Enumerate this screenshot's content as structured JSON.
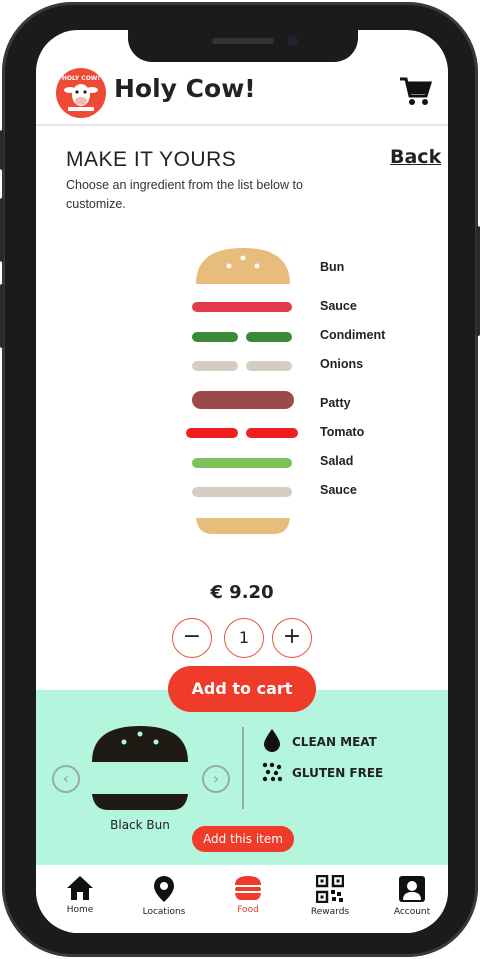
{
  "header": {
    "title": "Holy Cow!",
    "logo_text": "HOLY COW!"
  },
  "customize": {
    "title": "MAKE IT YOURS",
    "back_label": "Back",
    "subtitle": "Choose an ingredient from the list below to customize."
  },
  "layers": [
    {
      "label": "Bun",
      "color": "#e8bc7a",
      "icon": "top-bun"
    },
    {
      "label": "Sauce",
      "color": "#e23b4c",
      "icon": "sauce"
    },
    {
      "label": "Condiment",
      "color": "#3a8a37",
      "icon": "condiment"
    },
    {
      "label": "Onions",
      "color": "#d4cec2",
      "icon": "onions"
    },
    {
      "label": "Patty",
      "color": "#9b4a4a",
      "icon": "patty"
    },
    {
      "label": "Tomato",
      "color": "#f21d1d",
      "icon": "tomato"
    },
    {
      "label": "Salad",
      "color": "#7cc159",
      "icon": "salad"
    },
    {
      "label": "Sauce",
      "color": "#d4cec2",
      "icon": "sauce"
    },
    {
      "label": "",
      "color": "#e8bc7a",
      "icon": "bottom-bun"
    }
  ],
  "order": {
    "price": "€ 9.20",
    "quantity": "1",
    "minus": "−",
    "plus": "+",
    "add_to_cart": "Add to cart"
  },
  "selector": {
    "item_name": "Black Bun",
    "add_item": "Add this item",
    "prev": "‹",
    "next": "›",
    "features": [
      {
        "label": "CLEAN MEAT",
        "icon": "drop-icon"
      },
      {
        "label": "GLUTEN FREE",
        "icon": "dots-icon"
      }
    ]
  },
  "tabs": [
    {
      "label": "Home",
      "icon": "home-icon"
    },
    {
      "label": "Locations",
      "icon": "location-pin-icon"
    },
    {
      "label": "Food",
      "icon": "burger-icon",
      "active": true
    },
    {
      "label": "Rewards",
      "icon": "qr-code-icon"
    },
    {
      "label": "Account",
      "icon": "account-icon"
    }
  ],
  "colors": {
    "accent": "#ee3b2a",
    "mint": "#b4f5dd",
    "dark": "#222222"
  }
}
